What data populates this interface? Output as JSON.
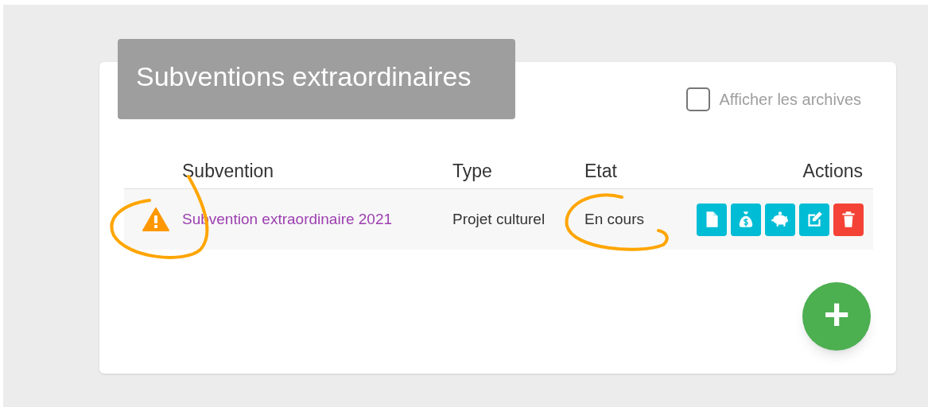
{
  "card": {
    "title": "Subventions extraordinaires",
    "archive_toggle": {
      "label": "Afficher les archives",
      "checked": false
    }
  },
  "table": {
    "columns": [
      "Subvention",
      "Type",
      "Etat",
      "Actions"
    ],
    "rows": [
      {
        "warning": true,
        "name": "Subvention extraordinaire 2021",
        "type": "Projet culturel",
        "state": "En cours",
        "actions": [
          {
            "kind": "document"
          },
          {
            "kind": "money-bag"
          },
          {
            "kind": "piggy-bank"
          },
          {
            "kind": "edit"
          },
          {
            "kind": "delete"
          }
        ]
      }
    ]
  },
  "add_button": {
    "label": "+"
  },
  "annotations": [
    {
      "kind": "hand-circle"
    },
    {
      "kind": "hand-circle"
    }
  ]
}
